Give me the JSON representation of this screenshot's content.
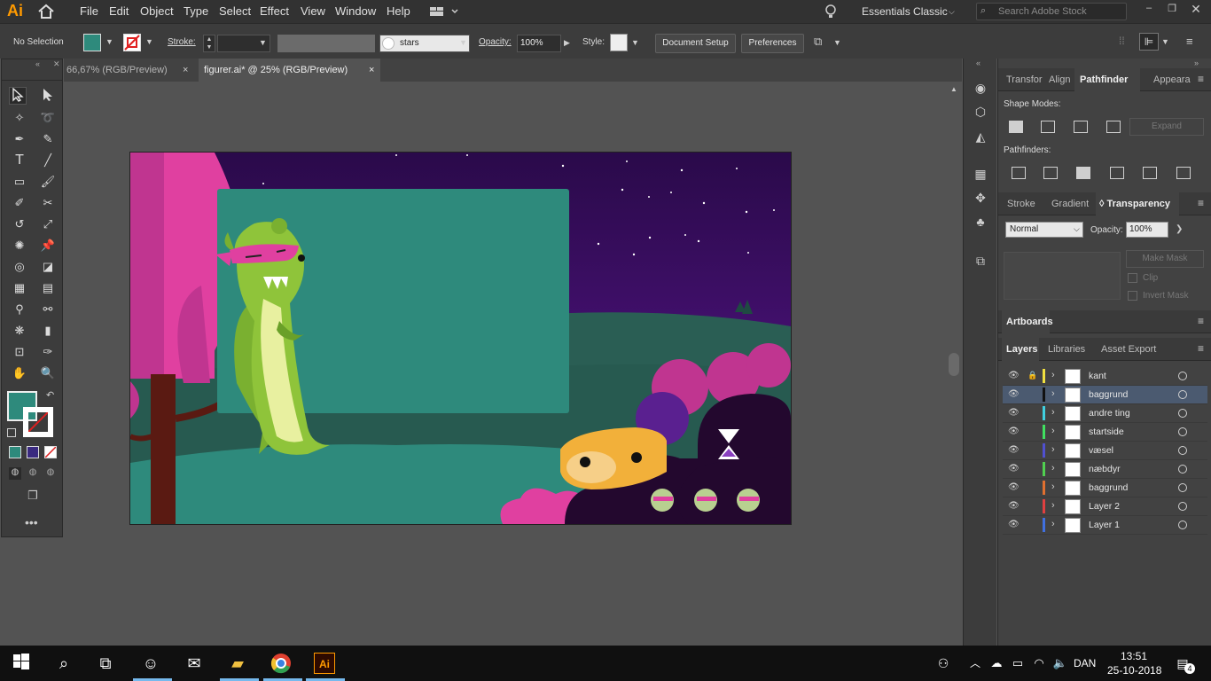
{
  "app": {
    "logo": "Ai"
  },
  "menu": [
    "File",
    "Edit",
    "Object",
    "Type",
    "Select",
    "Effect",
    "View",
    "Window",
    "Help"
  ],
  "workspace": "Essentials Classic",
  "search": {
    "placeholder": "Search Adobe Stock"
  },
  "control_bar": {
    "selection": "No Selection",
    "stroke_label": "Stroke:",
    "brush_value": "stars",
    "opacity_label": "Opacity:",
    "opacity_value": "100%",
    "style_label": "Style:",
    "document_setup": "Document Setup",
    "preferences": "Preferences"
  },
  "doc_tabs": [
    {
      "label": "66,67% (RGB/Preview)",
      "close": "×"
    },
    {
      "label": "figurer.ai* @ 25% (RGB/Preview)",
      "close": "×"
    }
  ],
  "colors": {
    "fill": "#2e8a7c",
    "accent": "#3a8fd8"
  },
  "panels": {
    "top_tabs": [
      "Transfor",
      "Align",
      "Pathfinder",
      "Appeara"
    ],
    "shape_modes_label": "Shape Modes:",
    "expand": "Expand",
    "pathfinders_label": "Pathfinders:",
    "mid_tabs": [
      "Stroke",
      "Gradient",
      "◊ Transparency"
    ],
    "blend_mode": "Normal",
    "t_opacity_label": "Opacity:",
    "t_opacity_value": "100%",
    "make_mask": "Make Mask",
    "clip": "Clip",
    "invert_mask": "Invert Mask",
    "artboards": "Artboards",
    "layer_tabs": [
      "Layers",
      "Libraries",
      "Asset Export"
    ]
  },
  "layers": [
    {
      "name": "kant",
      "color": "#f0e040",
      "locked": true
    },
    {
      "name": "baggrund",
      "color": "#111111",
      "locked": false,
      "selected": true
    },
    {
      "name": "andre ting",
      "color": "#40d0e0",
      "locked": false
    },
    {
      "name": "startside",
      "color": "#40e060",
      "locked": false
    },
    {
      "name": "væsel",
      "color": "#5050d0",
      "locked": false
    },
    {
      "name": "næbdyr",
      "color": "#50d050",
      "locked": false
    },
    {
      "name": "baggrund",
      "color": "#e07030",
      "locked": false
    },
    {
      "name": "Layer 2",
      "color": "#e04040",
      "locked": false
    },
    {
      "name": "Layer 1",
      "color": "#4070e0",
      "locked": false
    }
  ],
  "taskbar": {
    "language": "DAN",
    "time": "13:51",
    "date": "25-10-2018",
    "notifications": "4"
  }
}
